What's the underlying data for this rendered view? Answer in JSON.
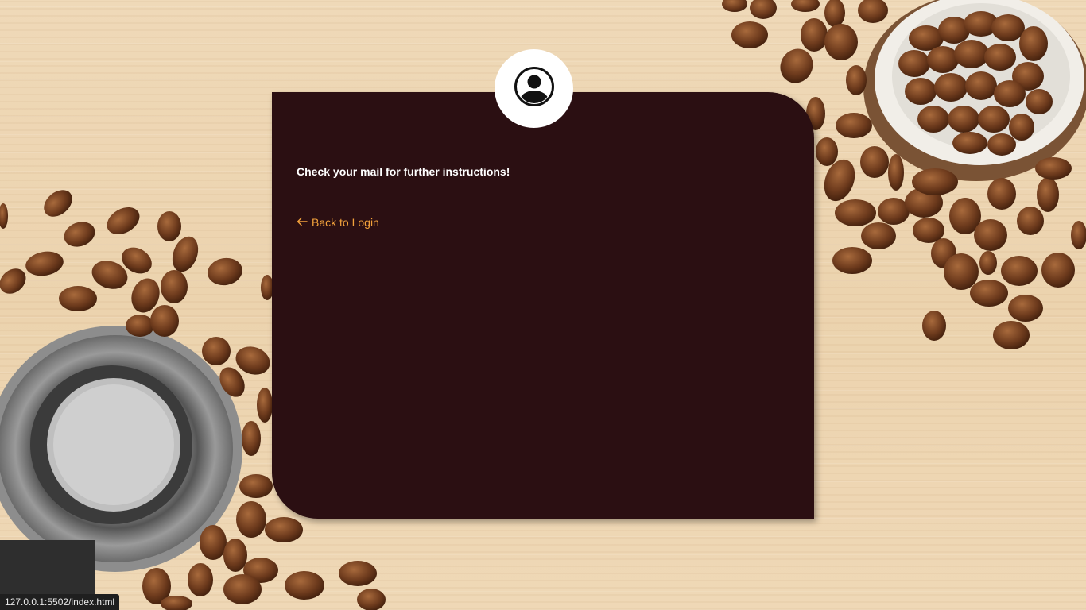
{
  "page": {
    "message": "Check your mail for further instructions!",
    "back_link_label": "Back to Login",
    "status_url": "127.0.0.1:5502/index.html"
  },
  "icons": {
    "avatar": "user-circle-icon",
    "back": "arrow-left-icon"
  },
  "colors": {
    "card_bg": "#2b0f12",
    "link": "#f3a23c",
    "message": "#ffffff",
    "avatar_bg": "#ffffff"
  }
}
